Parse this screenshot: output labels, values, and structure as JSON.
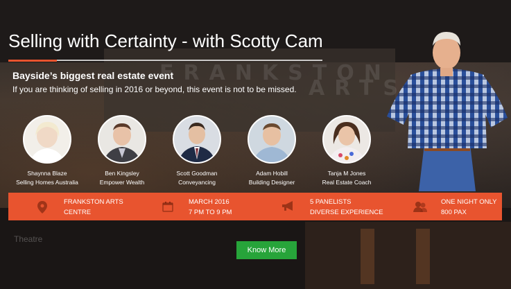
{
  "hero": {
    "title": "Selling with Certainty - with Scotty Cam",
    "subtitle": "Bayside’s biggest real estate event",
    "tagline": "If you are thinking of selling in 2016 or beyond, this event is not to be missed.",
    "bg_sign": "FRANKSTON",
    "bg_sign2": "ARTS",
    "bg_theatre": "Theatre"
  },
  "panelists": [
    {
      "name": "Shaynna Blaze",
      "role": "Selling Homes Australia"
    },
    {
      "name": "Ben Kingsley",
      "role": "Empower Wealth"
    },
    {
      "name": "Scott Goodman",
      "role": "Conveyancing"
    },
    {
      "name": "Adam Hobill",
      "role": "Building Designer"
    },
    {
      "name": "Tanja M Jones",
      "role": "Real Estate Coach"
    }
  ],
  "info": {
    "location": {
      "line1": "FRANKSTON ARTS",
      "line2": "CENTRE",
      "icon": "map-pin-icon"
    },
    "date": {
      "line1": "MARCH 2016",
      "line2": "7 PM TO 9 PM",
      "icon": "calendar-icon"
    },
    "panel": {
      "line1": "5 PANELISTS",
      "line2": "DIVERSE EXPERIENCE",
      "icon": "megaphone-icon"
    },
    "capacity": {
      "line1": "ONE NIGHT ONLY",
      "line2": "800 PAX",
      "icon": "users-icon"
    }
  },
  "cta": {
    "label": "Know More"
  },
  "colors": {
    "accent": "#e8542f",
    "cta": "#27a43a"
  }
}
